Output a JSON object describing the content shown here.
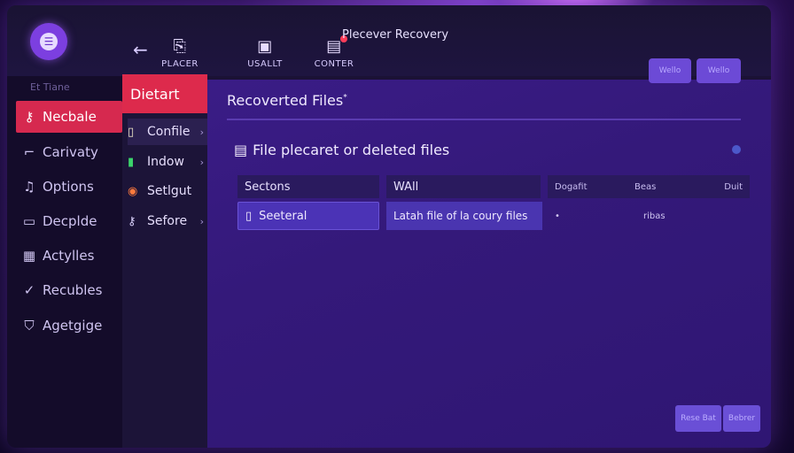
{
  "window": {
    "title": "Plecever Recovery"
  },
  "toolbar": {
    "items": [
      {
        "label": "PLACER",
        "icon": "document-icon"
      },
      {
        "label": "USALLT",
        "icon": "box-icon"
      },
      {
        "label": "CONTER",
        "icon": "clipboard-icon"
      }
    ],
    "right_buttons": [
      "Wello",
      "Wello"
    ]
  },
  "sidebar": {
    "section_label": "Et Tiane",
    "items": [
      {
        "label": "Necbale",
        "icon": "key-icon",
        "active": true
      },
      {
        "label": "Carivaty",
        "icon": "bracket-icon"
      },
      {
        "label": "Options",
        "icon": "music-note-icon"
      },
      {
        "label": "Decplde",
        "icon": "monitor-icon"
      },
      {
        "label": "Actylles",
        "icon": "grid-icon"
      },
      {
        "label": "Recubles",
        "icon": "check-icon"
      },
      {
        "label": "Agetgige",
        "icon": "shield-icon"
      }
    ]
  },
  "midcol": {
    "title": "Dietart",
    "items": [
      {
        "label": "Confile",
        "icon": "file-icon"
      },
      {
        "label": "Indow",
        "icon": "green-file-icon"
      },
      {
        "label": "Setlgut",
        "icon": "chrome-icon"
      },
      {
        "label": "Sefore",
        "icon": "key-icon"
      }
    ]
  },
  "main": {
    "title": "Recoverted Files",
    "title_mark": "*",
    "subtitle": "File plecaret or deleted files",
    "table": {
      "headers": [
        "Sectons",
        "WAll",
        "Dogafit",
        "Beas",
        "Duit"
      ],
      "row": {
        "section": "Seeteral",
        "description": "Latah file of la coury files",
        "col3": "•",
        "col4": "ribas"
      }
    },
    "footer_buttons": [
      "Rese Bat",
      "Bebrer"
    ]
  },
  "colors": {
    "accent": "#dd2a4c",
    "panel": "#3a1c86",
    "selection": "#4b33b6"
  }
}
